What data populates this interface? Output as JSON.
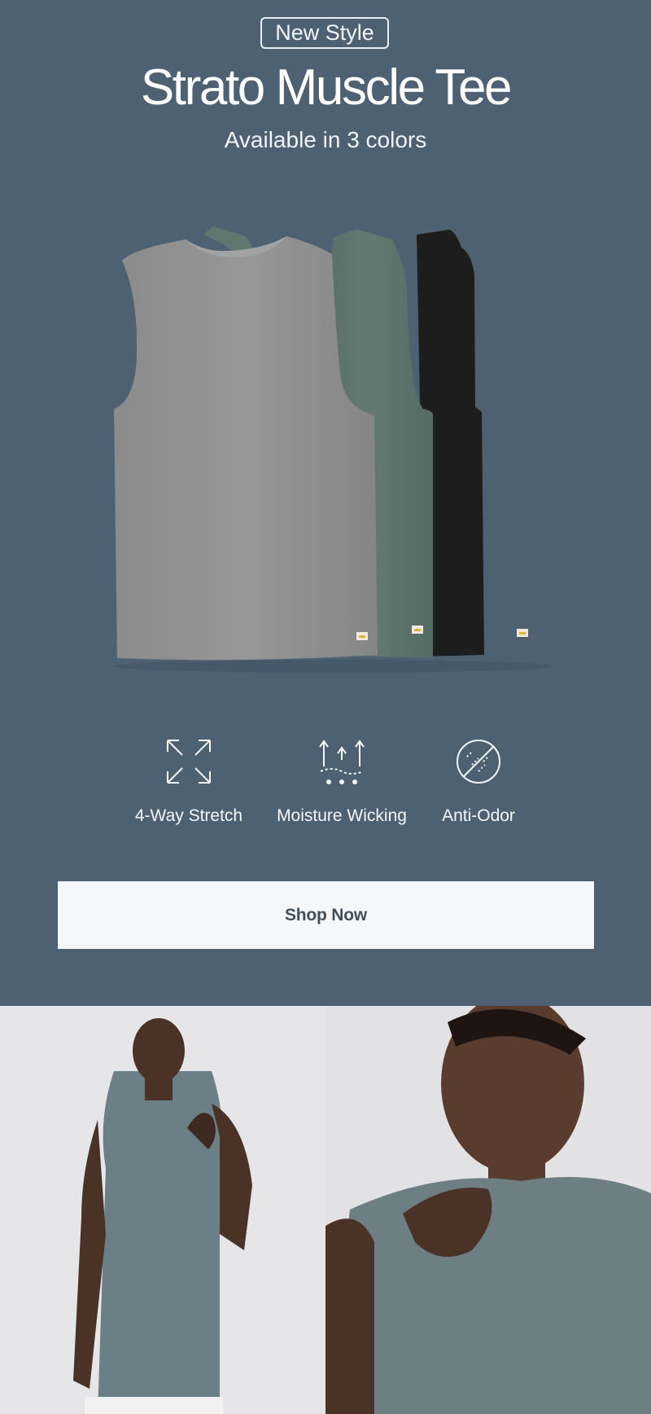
{
  "hero": {
    "badge": "New Style",
    "title": "Strato Muscle Tee",
    "subtitle": "Available in 3 colors",
    "image_alt": "three muscle tees in gray, green and black"
  },
  "features": [
    {
      "label": "4-Way Stretch",
      "icon": "stretch-arrows-icon"
    },
    {
      "label": "Moisture Wicking",
      "icon": "moisture-wicking-icon"
    },
    {
      "label": "Anti-Odor",
      "icon": "anti-odor-icon"
    }
  ],
  "cta": {
    "label": "Shop Now"
  },
  "colors": {
    "background": "#4e6173",
    "text": "#ffffff",
    "button_bg": "#f6f7f9",
    "button_text": "#41505e",
    "tee_gray": "#8f8f8f",
    "tee_green": "#5f776f",
    "tee_black": "#1d1d1d"
  }
}
